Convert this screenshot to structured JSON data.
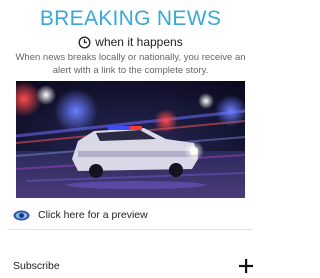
{
  "card": {
    "title": "BREAKING NEWS",
    "subtitle": "when it happens",
    "description": "When news breaks locally or nationally, you receive an alert with a link to the complete story."
  },
  "preview": {
    "label": "Click here for a preview",
    "icon": "eye-icon"
  },
  "subscribe": {
    "label": "Subscribe",
    "icon": "plus-icon"
  },
  "icons": {
    "clock": "clock-icon",
    "photo": "police-car-photo"
  },
  "colors": {
    "title": "#39a8d8",
    "eye_outer": "#2f4fa8",
    "eye_inner": "#7fb6ee"
  }
}
